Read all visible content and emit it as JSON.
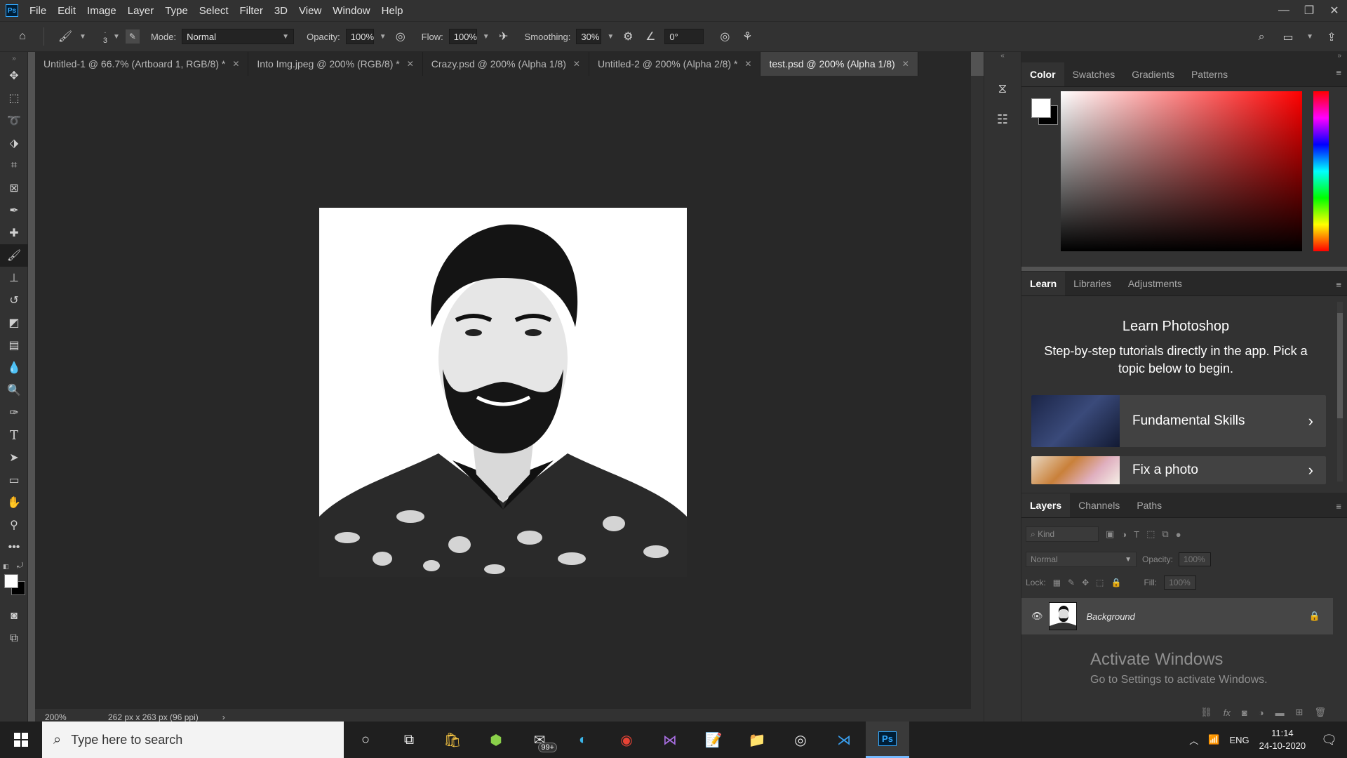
{
  "app": {
    "logo_text": "Ps",
    "logo_color": "#31a8ff"
  },
  "menu": [
    "File",
    "Edit",
    "Image",
    "Layer",
    "Type",
    "Select",
    "Filter",
    "3D",
    "View",
    "Window",
    "Help"
  ],
  "window_controls": {
    "minimize": "—",
    "restore": "❐",
    "close": "✕"
  },
  "options": {
    "brush_size": "3",
    "mode_label": "Mode:",
    "mode_value": "Normal",
    "opacity_label": "Opacity:",
    "opacity_value": "100%",
    "flow_label": "Flow:",
    "flow_value": "100%",
    "smoothing_label": "Smoothing:",
    "smoothing_value": "30%",
    "angle_value": "0°"
  },
  "doc_tabs": [
    {
      "title": "Untitled-1 @ 66.7% (Artboard 1, RGB/8) *"
    },
    {
      "title": "Into Img.jpeg @ 200% (RGB/8) *"
    },
    {
      "title": "Crazy.psd @ 200% (Alpha 1/8)"
    },
    {
      "title": "Untitled-2 @ 200% (Alpha 2/8) *"
    },
    {
      "title": "test.psd @ 200% (Alpha 1/8)",
      "active": true
    }
  ],
  "status": {
    "zoom": "200%",
    "doc_info": "262 px x 263 px (96 ppi)"
  },
  "color_panel": {
    "tabs": [
      "Color",
      "Swatches",
      "Gradients",
      "Patterns"
    ],
    "foreground": "#ffffff",
    "background": "#000000"
  },
  "learn_panel": {
    "tabs": [
      "Learn",
      "Libraries",
      "Adjustments"
    ],
    "title": "Learn Photoshop",
    "description": "Step-by-step tutorials directly in the app. Pick a topic below to begin.",
    "cards": [
      {
        "title": "Fundamental Skills"
      },
      {
        "title": "Fix a photo"
      }
    ]
  },
  "layers_panel": {
    "tabs": [
      "Layers",
      "Channels",
      "Paths"
    ],
    "filter_placeholder": "Kind",
    "blend_mode": "Normal",
    "opacity_label": "Opacity:",
    "opacity_value": "100%",
    "lock_label": "Lock:",
    "fill_label": "Fill:",
    "fill_value": "100%",
    "layers": [
      {
        "name": "Background",
        "visible": true,
        "locked": true
      }
    ]
  },
  "watermark": {
    "line1": "Activate Windows",
    "line2": "Go to Settings to activate Windows."
  },
  "taskbar": {
    "search_placeholder": "Type here to search",
    "mail_badge": "99+",
    "language": "ENG",
    "time": "11:14",
    "date": "24-10-2020"
  }
}
